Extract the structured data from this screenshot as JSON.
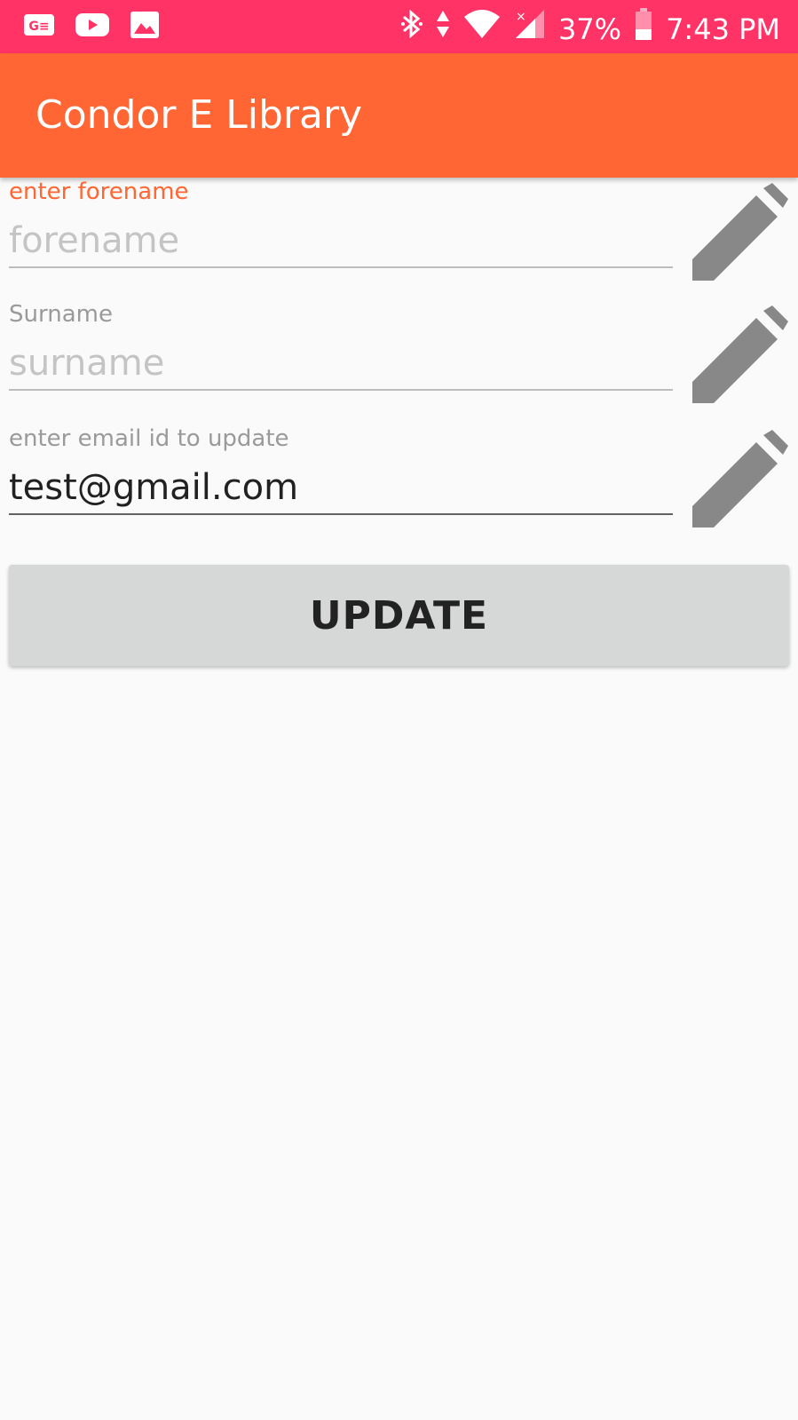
{
  "status_bar": {
    "background": "#ff3366",
    "left_icons": [
      "ge-icon",
      "youtube-icon",
      "gallery-icon"
    ],
    "right_icons": [
      "bluetooth-icon",
      "data-arrows-icon",
      "wifi-icon",
      "signal-icon",
      "battery-icon"
    ],
    "battery": "37%",
    "time": "7:43 PM"
  },
  "app_bar": {
    "title": "Condor E Library",
    "background": "#ff6633"
  },
  "form": {
    "forename": {
      "label": "enter forename",
      "placeholder": "forename",
      "value": "",
      "icon": "pencil-icon"
    },
    "surname": {
      "label": "Surname",
      "placeholder": "surname",
      "value": "",
      "icon": "pencil-icon"
    },
    "email": {
      "label": "enter email id to update",
      "placeholder": "",
      "value": "test@gmail.com",
      "icon": "pencil-icon"
    },
    "update_label": "UPDATE"
  },
  "colors": {
    "accent": "#ff6633",
    "icon_gray": "#888888",
    "button_bg": "#d6d7d7"
  }
}
